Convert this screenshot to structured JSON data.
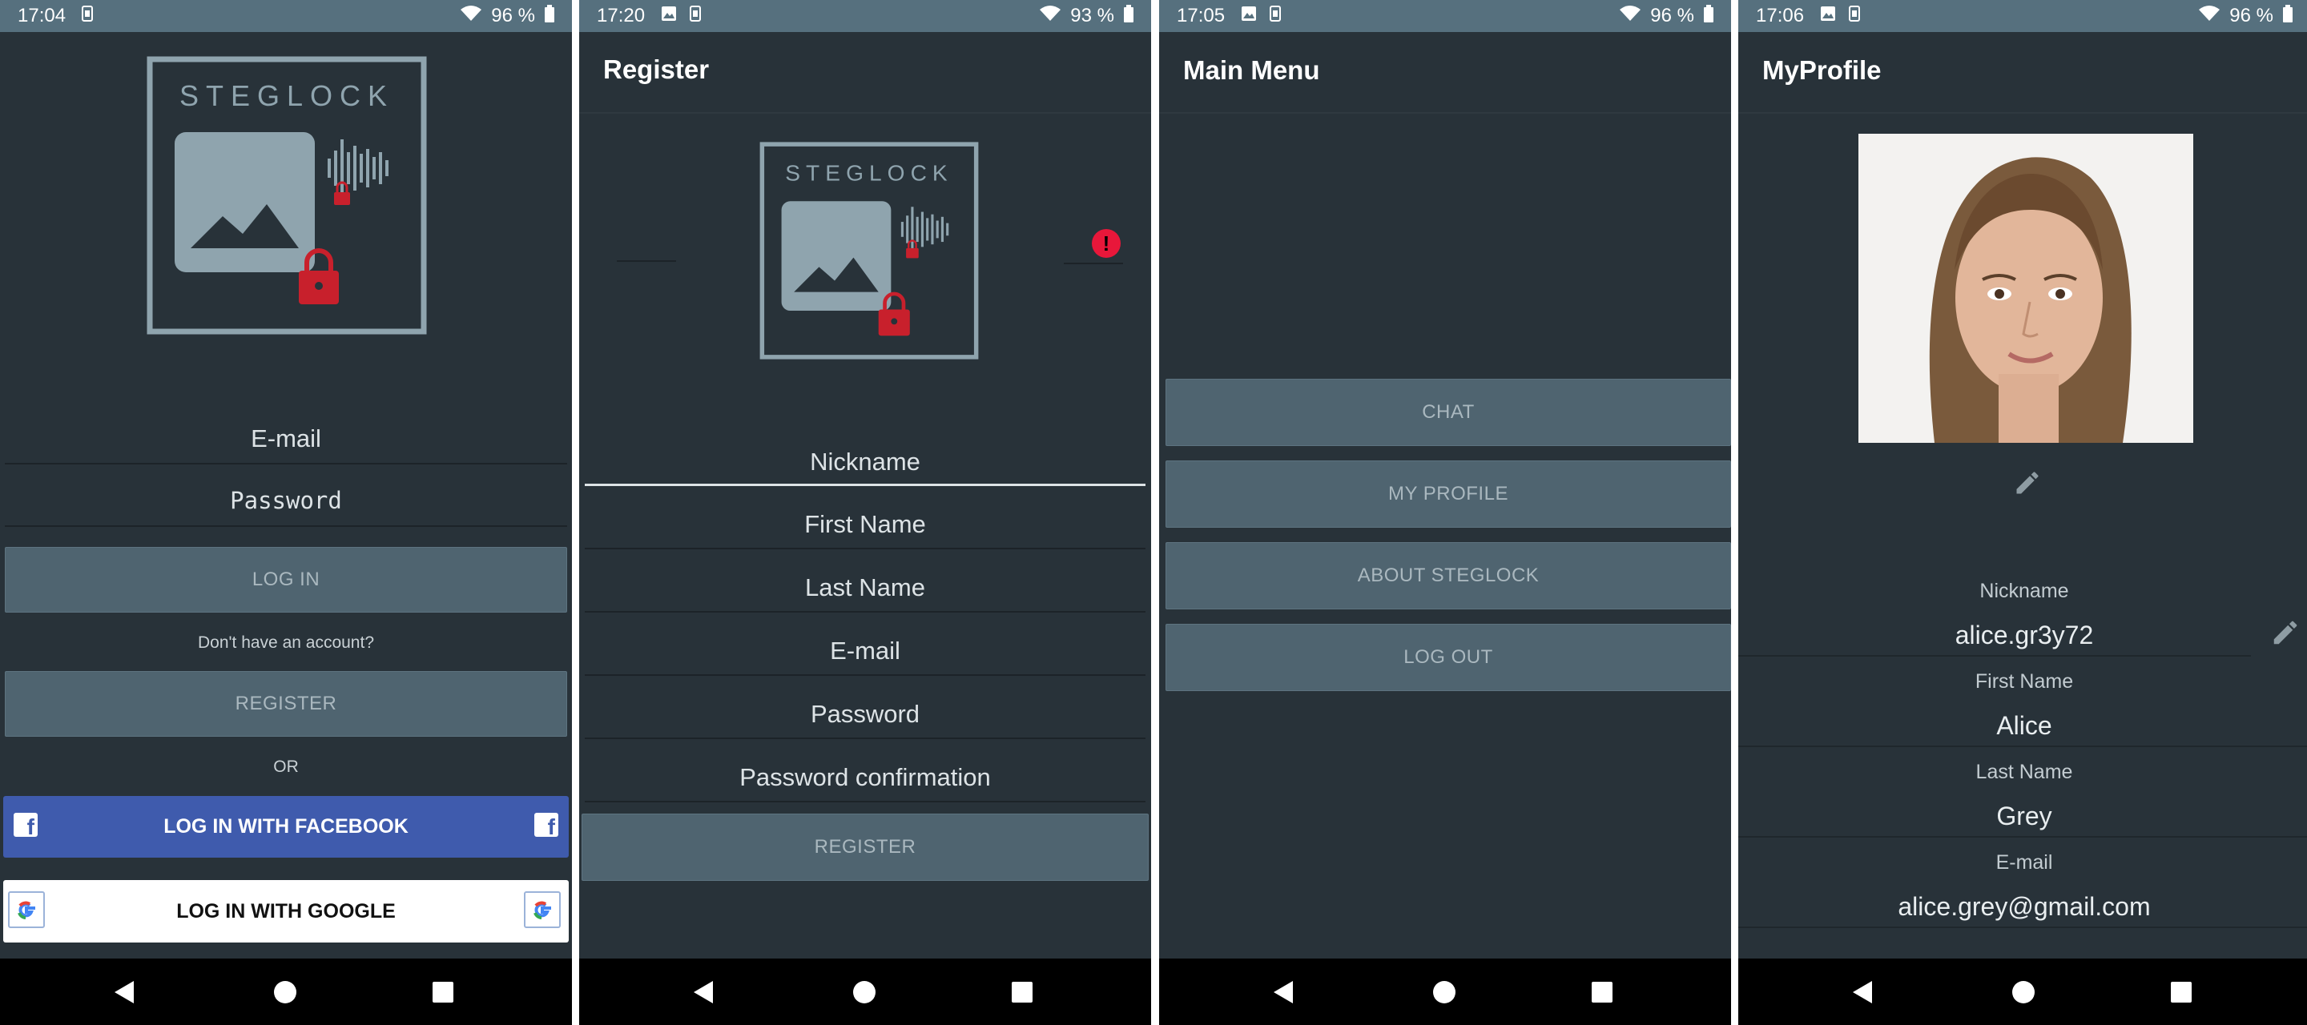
{
  "screens": {
    "login": {
      "status": {
        "time": "17:04",
        "battery": "96 %"
      },
      "logo_text": "STEGLOCK",
      "email_placeholder": "E-mail",
      "password_placeholder": "Password",
      "login_label": "LOG IN",
      "no_account_text": "Don't have an account?",
      "register_label": "REGISTER",
      "or_text": "OR",
      "facebook_label": "LOG IN WITH FACEBOOK",
      "google_label": "LOG IN WITH GOOGLE"
    },
    "register": {
      "status": {
        "time": "17:20",
        "battery": "93 %"
      },
      "title": "Register",
      "logo_text": "STEGLOCK",
      "error_mark": "!",
      "fields": {
        "nickname": "Nickname",
        "first_name": "First Name",
        "last_name": "Last Name",
        "email": "E-mail",
        "password": "Password",
        "password_confirmation": "Password confirmation"
      },
      "register_label": "REGISTER"
    },
    "main_menu": {
      "status": {
        "time": "17:05",
        "battery": "96 %"
      },
      "title": "Main Menu",
      "buttons": {
        "chat": "CHAT",
        "my_profile": "MY PROFILE",
        "about": "ABOUT STEGLOCK",
        "logout": "LOG OUT"
      }
    },
    "profile": {
      "status": {
        "time": "17:06",
        "battery": "96 %"
      },
      "title": "MyProfile",
      "nickname_label": "Nickname",
      "nickname_value": "alice.gr3y72",
      "first_name_label": "First Name",
      "first_name_value": "Alice",
      "last_name_label": "Last Name",
      "last_name_value": "Grey",
      "email_label": "E-mail",
      "email_value": "alice.grey@gmail.com"
    }
  },
  "icons": {
    "status": [
      "image-icon",
      "sim-icon",
      "wifi-icon",
      "battery-icon"
    ],
    "nav": [
      "back-icon",
      "home-icon",
      "recents-icon"
    ],
    "profile": [
      "profile-photo",
      "edit-pencil-icon"
    ]
  },
  "colors": {
    "background": "#283239",
    "statusbar": "#56707e",
    "button": "#4f6470",
    "facebook": "#3f5bad",
    "error": "#e8173a",
    "lock": "#c8202c"
  }
}
